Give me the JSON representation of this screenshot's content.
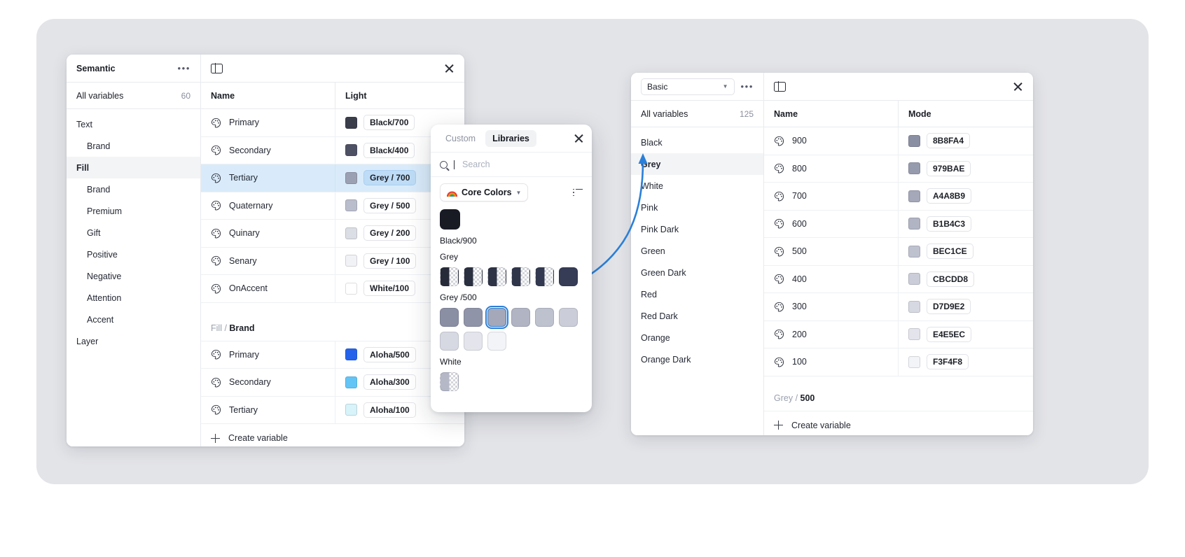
{
  "semantic_panel": {
    "title": "Semantic",
    "more_label": "•••",
    "all_variables_label": "All variables",
    "all_variables_count": "60",
    "sidebar_items": [
      {
        "label": "Text",
        "indent": false,
        "active": false,
        "bold": false
      },
      {
        "label": "Brand",
        "indent": true,
        "active": false,
        "bold": false
      },
      {
        "label": "Fill",
        "indent": false,
        "active": true,
        "bold": true
      },
      {
        "label": "Brand",
        "indent": true,
        "active": false,
        "bold": false
      },
      {
        "label": "Premium",
        "indent": true,
        "active": false,
        "bold": false
      },
      {
        "label": "Gift",
        "indent": true,
        "active": false,
        "bold": false
      },
      {
        "label": "Positive",
        "indent": true,
        "active": false,
        "bold": false
      },
      {
        "label": "Negative",
        "indent": true,
        "active": false,
        "bold": false
      },
      {
        "label": "Attention",
        "indent": true,
        "active": false,
        "bold": false
      },
      {
        "label": "Accent",
        "indent": true,
        "active": false,
        "bold": false
      },
      {
        "label": "Layer",
        "indent": false,
        "active": false,
        "bold": false
      }
    ],
    "columns": {
      "name": "Name",
      "value": "Light"
    },
    "rows": [
      {
        "name": "Primary",
        "chip": "Black/700",
        "color": "#3a3d4a",
        "selected": false
      },
      {
        "name": "Secondary",
        "chip": "Black/400",
        "color": "#4e5163",
        "selected": false
      },
      {
        "name": "Tertiary",
        "chip": "Grey / 700",
        "color": "#9ba0b2",
        "selected": true
      },
      {
        "name": "Quaternary",
        "chip": "Grey / 500",
        "color": "#babdcb",
        "selected": false
      },
      {
        "name": "Quinary",
        "chip": "Grey / 200",
        "color": "#dcdee5",
        "selected": false
      },
      {
        "name": "Senary",
        "chip": "Grey / 100",
        "color": "#f1f2f6",
        "selected": false
      },
      {
        "name": "OnAccent",
        "chip": "White/100",
        "color": "#ffffff",
        "selected": false
      }
    ],
    "group_header": {
      "prefix": "Fill",
      "separator": " / ",
      "name": "Brand"
    },
    "rows2": [
      {
        "name": "Primary",
        "chip": "Aloha/500",
        "color": "#2563eb",
        "selected": false
      },
      {
        "name": "Secondary",
        "chip": "Aloha/300",
        "color": "#63c5f5",
        "selected": false
      },
      {
        "name": "Tertiary",
        "chip": "Aloha/100",
        "color": "#d8f3fa",
        "selected": false
      }
    ],
    "create_label": "Create variable"
  },
  "color_picker": {
    "tabs": [
      {
        "label": "Custom",
        "active": false
      },
      {
        "label": "Libraries",
        "active": true
      }
    ],
    "search_placeholder": "Search",
    "search_value": "",
    "library_label": "Core Colors",
    "library_icon": "rainbow-icon",
    "sections": [
      {
        "label": "Black/900",
        "swatch_size": "big",
        "swatches": [
          {
            "color": "#181b24",
            "checker": false,
            "selected": false
          }
        ]
      },
      {
        "label": "Grey",
        "swatch_size": "normal",
        "swatches": [
          {
            "color": "#272b39",
            "checker": true,
            "selected": false
          },
          {
            "color": "#2b3040",
            "checker": true,
            "selected": false
          },
          {
            "color": "#2e3345",
            "checker": true,
            "selected": false
          },
          {
            "color": "#30364a",
            "checker": true,
            "selected": false
          },
          {
            "color": "#333950",
            "checker": true,
            "selected": false
          },
          {
            "color": "#363c55",
            "checker": false,
            "selected": false
          }
        ]
      },
      {
        "label": "Grey /500",
        "swatch_size": "normal",
        "swatches": [
          {
            "color": "#8b8fa4",
            "checker": false,
            "selected": false
          },
          {
            "color": "#9094a8",
            "checker": false,
            "selected": false
          },
          {
            "color": "#a4a8b9",
            "checker": false,
            "selected": true
          },
          {
            "color": "#b1b4c3",
            "checker": false,
            "selected": false
          },
          {
            "color": "#bec1ce",
            "checker": false,
            "selected": false
          },
          {
            "color": "#cbcdd8",
            "checker": false,
            "selected": false
          },
          {
            "color": "#d7d9e2",
            "checker": false,
            "selected": false
          },
          {
            "color": "#e4e5ec",
            "checker": false,
            "selected": false
          },
          {
            "color": "#f3f4f8",
            "checker": false,
            "selected": false
          }
        ]
      },
      {
        "label": "White",
        "swatch_size": "normal",
        "swatches": [
          {
            "color": "#b4b8c7",
            "checker": true,
            "selected": false
          }
        ]
      }
    ]
  },
  "basic_panel": {
    "library_select": "Basic",
    "more_label": "•••",
    "all_variables_label": "All variables",
    "all_variables_count": "125",
    "sidebar_items": [
      {
        "label": "Black",
        "active": false
      },
      {
        "label": "Grey",
        "active": true
      },
      {
        "label": "White",
        "active": false
      },
      {
        "label": "Pink",
        "active": false
      },
      {
        "label": "Pink Dark",
        "active": false
      },
      {
        "label": "Green",
        "active": false
      },
      {
        "label": "Green Dark",
        "active": false
      },
      {
        "label": "Red",
        "active": false
      },
      {
        "label": "Red Dark",
        "active": false
      },
      {
        "label": "Orange",
        "active": false
      },
      {
        "label": "Orange Dark",
        "active": false
      }
    ],
    "columns": {
      "name": "Name",
      "value": "Mode"
    },
    "rows": [
      {
        "name": "900",
        "chip": "8B8FA4",
        "color": "#8b8fa4"
      },
      {
        "name": "800",
        "chip": "979BAE",
        "color": "#979bae"
      },
      {
        "name": "700",
        "chip": "A4A8B9",
        "color": "#a4a8b9"
      },
      {
        "name": "600",
        "chip": "B1B4C3",
        "color": "#b1b4c3"
      },
      {
        "name": "500",
        "chip": "BEC1CE",
        "color": "#bec1ce"
      },
      {
        "name": "400",
        "chip": "CBCDD8",
        "color": "#cbcdd8"
      },
      {
        "name": "300",
        "chip": "D7D9E2",
        "color": "#d7d9e2"
      },
      {
        "name": "200",
        "chip": "E4E5EC",
        "color": "#e4e5ec"
      },
      {
        "name": "100",
        "chip": "F3F4F8",
        "color": "#f3f4f8"
      }
    ],
    "group_header": {
      "prefix": "Grey",
      "separator": " / ",
      "name": "500"
    },
    "create_label": "Create variable"
  },
  "accent_color": "#2b7fd8"
}
